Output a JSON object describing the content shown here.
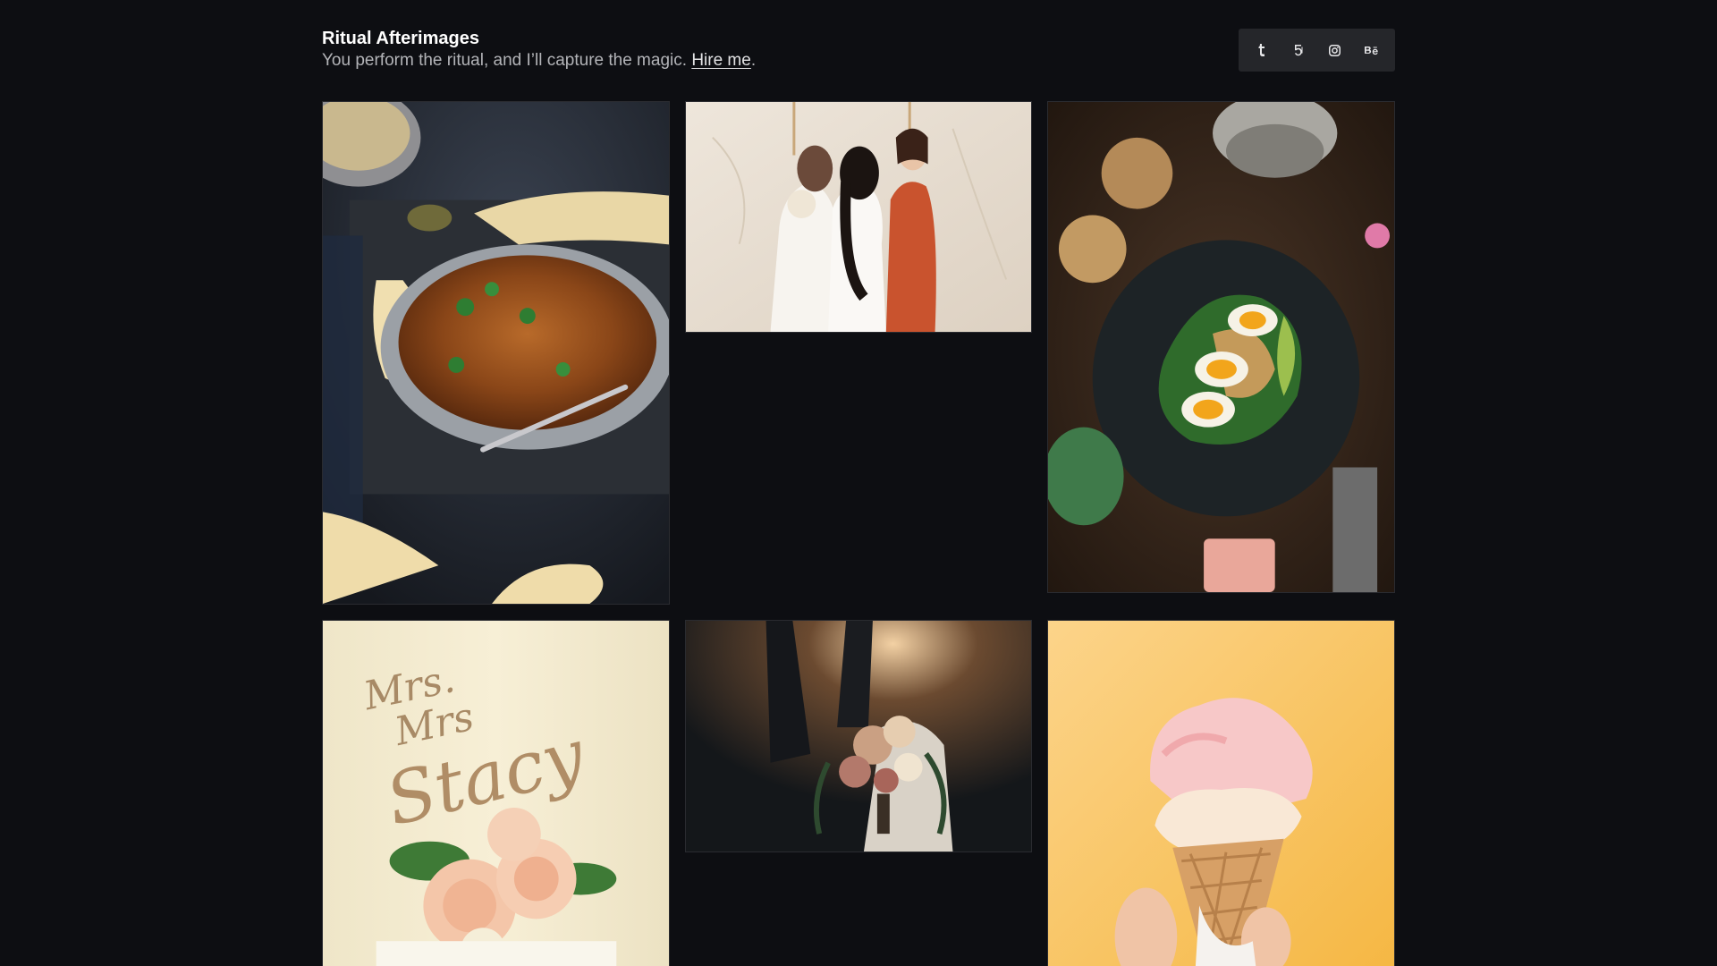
{
  "header": {
    "title": "Ritual Afterimages",
    "tagline_text": "You perform the ritual, and I’ll capture the magic.",
    "hire_link": "Hire me",
    "tagline_end": "."
  },
  "social": [
    {
      "name": "tumblr-icon",
      "glyph": "t"
    },
    {
      "name": "fivehundredpx-icon",
      "glyph": "5"
    },
    {
      "name": "instagram-icon",
      "glyph": ""
    },
    {
      "name": "behance-icon",
      "glyph": "Bē"
    }
  ],
  "gallery": {
    "photos": [
      {
        "subject": "curry dish with naan"
      },
      {
        "subject": "wedding couple embracing"
      },
      {
        "subject": "egg and avocado toast"
      },
      {
        "subject": "wedding cake topper with roses"
      },
      {
        "subject": "bridal bouquet in sunlight"
      },
      {
        "subject": "ice cream cone"
      }
    ]
  },
  "colors": {
    "background": "#0d0e12",
    "social_bg": "#25262a",
    "text": "#ffffff",
    "muted_text": "#b3b4b8"
  }
}
